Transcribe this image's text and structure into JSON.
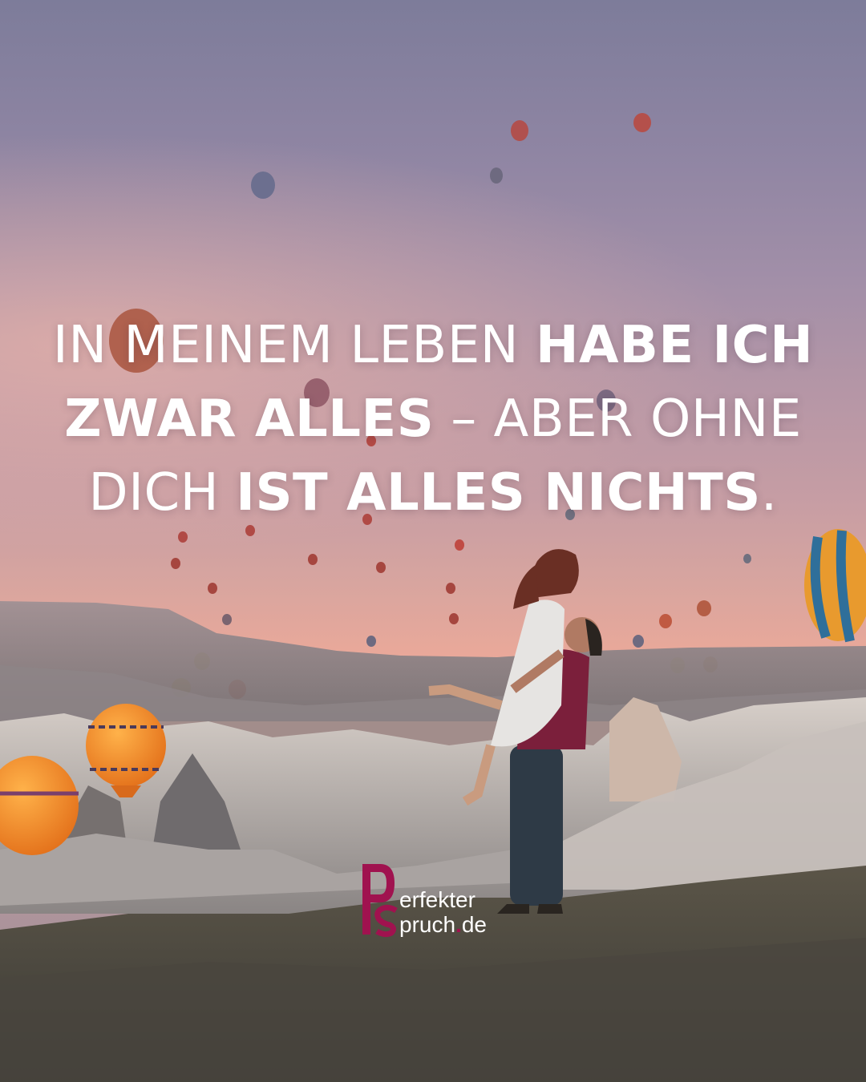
{
  "quote": {
    "lines": [
      [
        {
          "text": "IN MEINEM LEBEN ",
          "weight": "light"
        },
        {
          "text": "HABE ICH",
          "weight": "bold"
        }
      ],
      [
        {
          "text": "ZWAR ALLES",
          "weight": "bold"
        },
        {
          "text": " – ABER OHNE",
          "weight": "light"
        }
      ],
      [
        {
          "text": "DICH ",
          "weight": "light"
        },
        {
          "text": "IST ALLES NICHTS",
          "weight": "bold"
        },
        {
          "text": ".",
          "weight": "light"
        }
      ]
    ]
  },
  "logo": {
    "line1": "erfekter",
    "line2_a": "pruch",
    "dot": ".",
    "line2_b": "de",
    "brand_color": "#a0124f"
  }
}
